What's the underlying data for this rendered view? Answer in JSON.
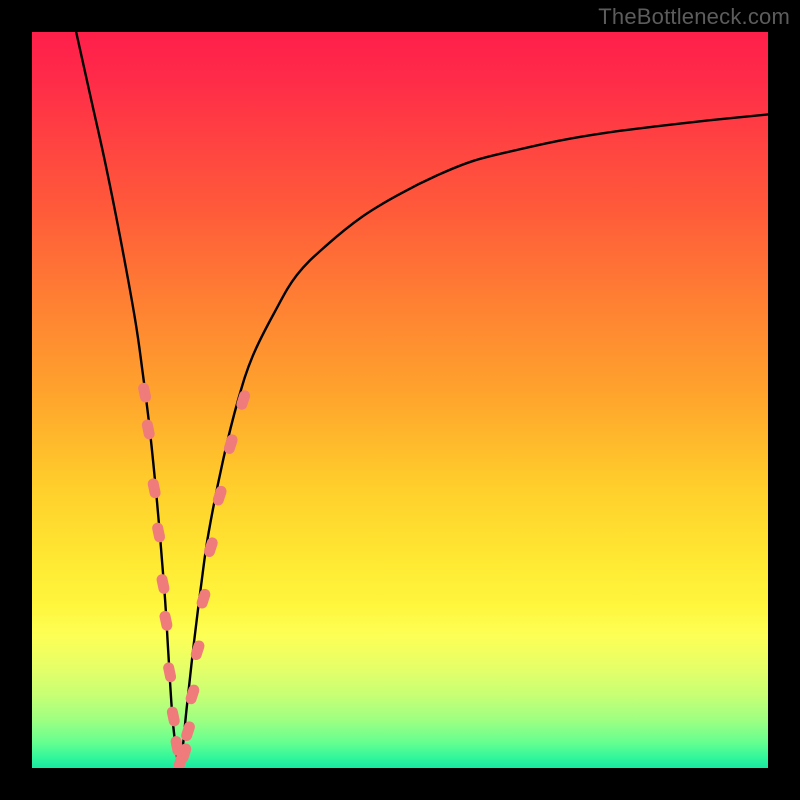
{
  "watermark": "TheBottleneck.com",
  "colors": {
    "frame": "#000000",
    "curve": "#000000",
    "marker_fill": "#ef7c7a",
    "marker_stroke": "#e36a68",
    "gradient_stops": [
      {
        "offset": 0.0,
        "color": "#ff1f4a"
      },
      {
        "offset": 0.06,
        "color": "#ff2a49"
      },
      {
        "offset": 0.14,
        "color": "#ff4042"
      },
      {
        "offset": 0.24,
        "color": "#ff5a3a"
      },
      {
        "offset": 0.36,
        "color": "#ff7e33"
      },
      {
        "offset": 0.5,
        "color": "#ffa62c"
      },
      {
        "offset": 0.62,
        "color": "#ffcf2b"
      },
      {
        "offset": 0.72,
        "color": "#ffe933"
      },
      {
        "offset": 0.78,
        "color": "#fff63e"
      },
      {
        "offset": 0.82,
        "color": "#fdff55"
      },
      {
        "offset": 0.86,
        "color": "#e8ff66"
      },
      {
        "offset": 0.9,
        "color": "#c8ff74"
      },
      {
        "offset": 0.935,
        "color": "#9dff82"
      },
      {
        "offset": 0.965,
        "color": "#66ff90"
      },
      {
        "offset": 0.985,
        "color": "#33f79a"
      },
      {
        "offset": 1.0,
        "color": "#18e8a0"
      }
    ]
  },
  "chart_data": {
    "type": "line",
    "title": "",
    "xlabel": "",
    "ylabel": "",
    "xlim": [
      0,
      100
    ],
    "ylim": [
      0,
      100
    ],
    "series": [
      {
        "name": "bottleneck-curve",
        "x": [
          6,
          8,
          10,
          12,
          14,
          15,
          16,
          17,
          18,
          18.5,
          19,
          19.5,
          20,
          20.5,
          21,
          22,
          23,
          24,
          26,
          28,
          30,
          33,
          36,
          40,
          45,
          50,
          55,
          60,
          66,
          72,
          78,
          85,
          92,
          100
        ],
        "y": [
          100,
          91,
          82,
          72,
          61,
          54,
          46,
          36,
          24,
          16,
          8,
          3,
          0.5,
          3,
          8,
          17,
          25,
          32,
          42,
          50,
          56,
          62,
          67,
          71,
          75,
          78,
          80.5,
          82.5,
          84,
          85.3,
          86.3,
          87.2,
          88,
          88.8
        ]
      }
    ],
    "markers": {
      "name": "highlighted-points",
      "points": [
        {
          "x": 15.3,
          "y": 51
        },
        {
          "x": 15.8,
          "y": 46
        },
        {
          "x": 16.6,
          "y": 38
        },
        {
          "x": 17.2,
          "y": 32
        },
        {
          "x": 17.8,
          "y": 25
        },
        {
          "x": 18.2,
          "y": 20
        },
        {
          "x": 18.7,
          "y": 13
        },
        {
          "x": 19.2,
          "y": 7
        },
        {
          "x": 19.7,
          "y": 3
        },
        {
          "x": 20.2,
          "y": 1
        },
        {
          "x": 20.7,
          "y": 2
        },
        {
          "x": 21.2,
          "y": 5
        },
        {
          "x": 21.8,
          "y": 10
        },
        {
          "x": 22.5,
          "y": 16
        },
        {
          "x": 23.3,
          "y": 23
        },
        {
          "x": 24.3,
          "y": 30
        },
        {
          "x": 25.5,
          "y": 37
        },
        {
          "x": 27.0,
          "y": 44
        },
        {
          "x": 28.7,
          "y": 50
        }
      ]
    }
  }
}
